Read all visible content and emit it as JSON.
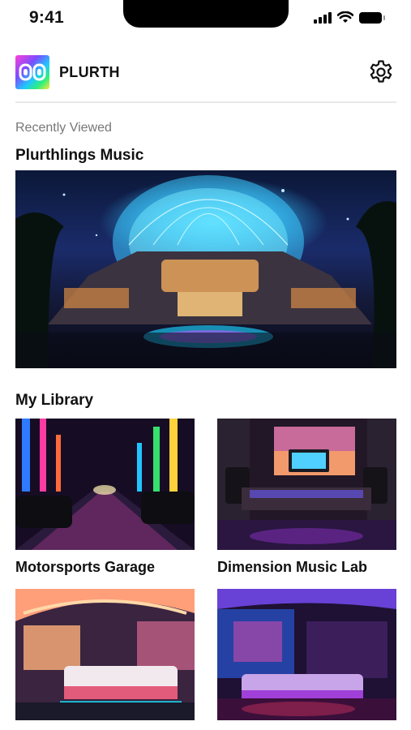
{
  "status_bar": {
    "time": "9:41"
  },
  "header": {
    "app_name": "PLURTH"
  },
  "recently_viewed": {
    "caption": "Recently Viewed",
    "title": "Plurthlings Music"
  },
  "library": {
    "title": "My Library",
    "items": [
      {
        "label": "Motorsports Garage"
      },
      {
        "label": "Dimension Music Lab"
      },
      {
        "label": ""
      },
      {
        "label": ""
      }
    ]
  },
  "icons": {
    "settings": "gear-icon",
    "logo": "plurth-logo",
    "signal": "cellular-signal-icon",
    "wifi": "wifi-icon",
    "battery": "battery-icon"
  }
}
